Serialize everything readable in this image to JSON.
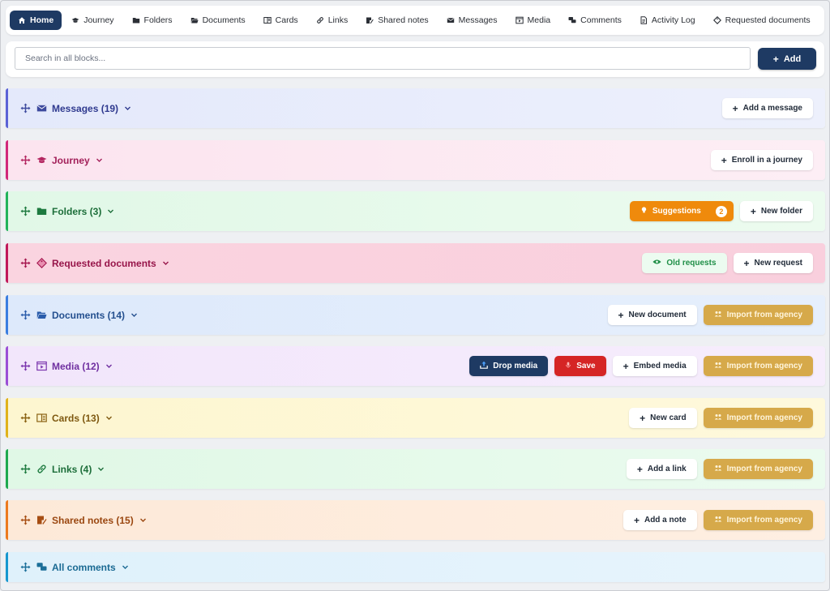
{
  "tabs": [
    {
      "label": "Home",
      "icon": "home-icon",
      "active": true
    },
    {
      "label": "Journey",
      "icon": "graduation-cap-icon"
    },
    {
      "label": "Folders",
      "icon": "folder-icon"
    },
    {
      "label": "Documents",
      "icon": "folder-open-icon"
    },
    {
      "label": "Cards",
      "icon": "cards-icon"
    },
    {
      "label": "Links",
      "icon": "link-icon"
    },
    {
      "label": "Shared notes",
      "icon": "note-icon"
    },
    {
      "label": "Messages",
      "icon": "envelope-icon"
    },
    {
      "label": "Media",
      "icon": "media-icon"
    },
    {
      "label": "Comments",
      "icon": "comments-icon"
    },
    {
      "label": "Activity Log",
      "icon": "log-icon"
    },
    {
      "label": "Requested documents",
      "icon": "tag-icon"
    }
  ],
  "search": {
    "placeholder": "Search in all blocks...",
    "add_label": "Add"
  },
  "blocks": {
    "messages": {
      "title": "Messages (19)",
      "add": "Add a message",
      "color": "#6366f1"
    },
    "journey": {
      "title": "Journey",
      "add": "Enroll in a journey",
      "color": "#db2777"
    },
    "folders": {
      "title": "Folders (3)",
      "suggestions": "Suggestions",
      "suggestions_count": "2",
      "add": "New folder",
      "color": "#22c55e"
    },
    "requested": {
      "title": "Requested documents",
      "old": "Old requests",
      "add": "New request",
      "color": "#be185d"
    },
    "documents": {
      "title": "Documents (14)",
      "add": "New document",
      "import": "Import from agency",
      "color": "#3b82f6"
    },
    "media": {
      "title": "Media (12)",
      "drop": "Drop media",
      "save": "Save",
      "embed": "Embed media",
      "import": "Import from agency",
      "color": "#a855f7"
    },
    "cards": {
      "title": "Cards (13)",
      "add": "New card",
      "import": "Import from agency",
      "color": "#eab308"
    },
    "links": {
      "title": "Links (4)",
      "add": "Add a link",
      "import": "Import from agency",
      "color": "#16a34a"
    },
    "notes": {
      "title": "Shared notes (15)",
      "add": "Add a note",
      "import": "Import from agency",
      "color": "#f97316"
    },
    "comments": {
      "title": "All comments",
      "color": "#0ea5e9"
    }
  }
}
